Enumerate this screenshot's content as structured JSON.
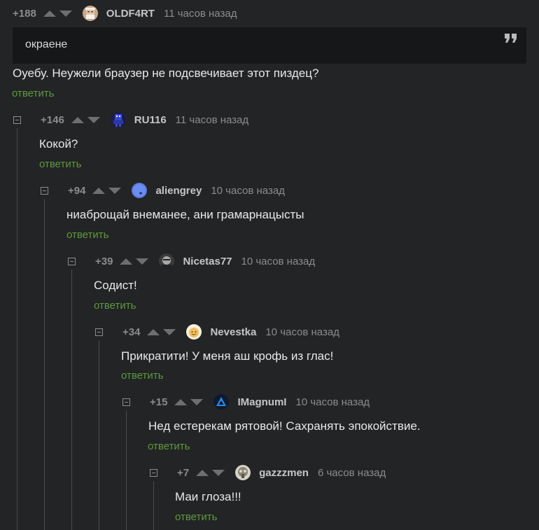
{
  "comments": [
    {
      "rating": "+188",
      "author": "OLDF4RT",
      "time": "11 часов назад",
      "quote": "окраене",
      "text": "Оуебу. Неужели браузер не подсвечивает этот пиздец?",
      "reply_label": "ответить",
      "avatar_icon": "old-man-avatar"
    },
    {
      "rating": "+146",
      "author": "RU116",
      "time": "11 часов назад",
      "text": "Кокой?",
      "reply_label": "ответить",
      "avatar_icon": "pixel-robot-avatar"
    },
    {
      "rating": "+94",
      "author": "aliengrey",
      "time": "10 часов назад",
      "text": "ниаброщай внеманее, ани грамарнацысты",
      "reply_label": "ответить",
      "avatar_icon": "blue-alien-avatar"
    },
    {
      "rating": "+39",
      "author": "Nicetas77",
      "time": "10 часов назад",
      "text": "Содист!",
      "reply_label": "ответить",
      "avatar_icon": "dark-face-avatar"
    },
    {
      "rating": "+34",
      "author": "Nevestka",
      "time": "10 часов назад",
      "text": "Прикратити! У меня аш крофь из глас!",
      "reply_label": "ответить",
      "avatar_icon": "cartoon-face-avatar"
    },
    {
      "rating": "+15",
      "author": "IMagnumI",
      "time": "10 часов назад",
      "text": "Нед естерекам рятовой! Сахранять эпокойствие.",
      "reply_label": "ответить",
      "avatar_icon": "blue-triangle-logo-avatar"
    },
    {
      "rating": "+7",
      "author": "gazzzmen",
      "time": "6 часов назад",
      "text": "Маи глоза!!!",
      "reply_label": "ответить",
      "avatar_icon": "gas-mask-avatar"
    }
  ]
}
